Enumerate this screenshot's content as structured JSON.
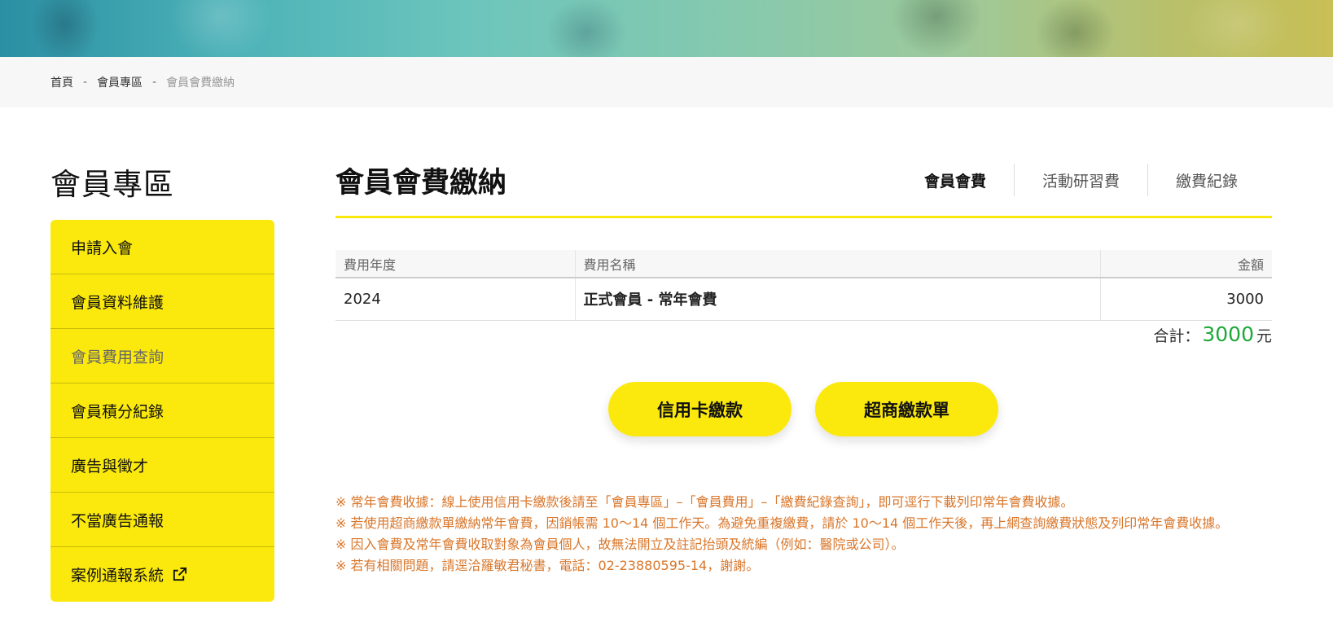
{
  "breadcrumb": {
    "items": [
      "首頁",
      "會員專區",
      "會員會費繳納"
    ],
    "separator": "-"
  },
  "sidebar": {
    "title": "會員專區",
    "items": [
      {
        "label": "申請入會"
      },
      {
        "label": "會員資料維護"
      },
      {
        "label": "會員費用查詢"
      },
      {
        "label": "會員積分紀錄"
      },
      {
        "label": "廣告與徵才"
      },
      {
        "label": "不當廣告通報"
      },
      {
        "label": "案例通報系統"
      }
    ],
    "active_item": "會員費用查詢",
    "external_icon": "external-link-icon"
  },
  "main": {
    "title": "會員會費繳納",
    "tabs": [
      {
        "label": "會員會費"
      },
      {
        "label": "活動研習費"
      },
      {
        "label": "繳費紀錄"
      }
    ],
    "active_tab": "會員會費"
  },
  "fees_table": {
    "headers": [
      "費用年度",
      "費用名稱",
      "金額"
    ],
    "rows": [
      {
        "year": "2024",
        "name": "正式會員 - 常年會費",
        "amount": "3000"
      }
    ]
  },
  "total": {
    "label": "合計：",
    "value": "3000",
    "unit": "元"
  },
  "buttons": {
    "credit_card": "信用卡繳款",
    "convenience_store": "超商繳款單"
  },
  "notes": [
    "※ 常年會費收據：線上使用信用卡繳款後請至「會員專區」–「會員費用」–「繳費紀錄查詢」，即可逕行下載列印常年會費收據。",
    "※ 若使用超商繳款單繳納常年會費，因銷帳需 10～14 個工作天。為避免重複繳費，請於 10～14 個工作天後，再上網查詢繳費狀態及列印常年會費收據。",
    "※ 因入會費及常年會費收取對象為會員個人，故無法開立及註記抬頭及統編（例如：醫院或公司）。",
    "※ 若有相關問題，請逕洽羅敏君秘書，電話：02-23880595-14，謝謝。"
  ],
  "colors": {
    "accent_yellow": "#fbe90e",
    "total_green": "#1ea83a",
    "note_orange": "#d9762a"
  }
}
